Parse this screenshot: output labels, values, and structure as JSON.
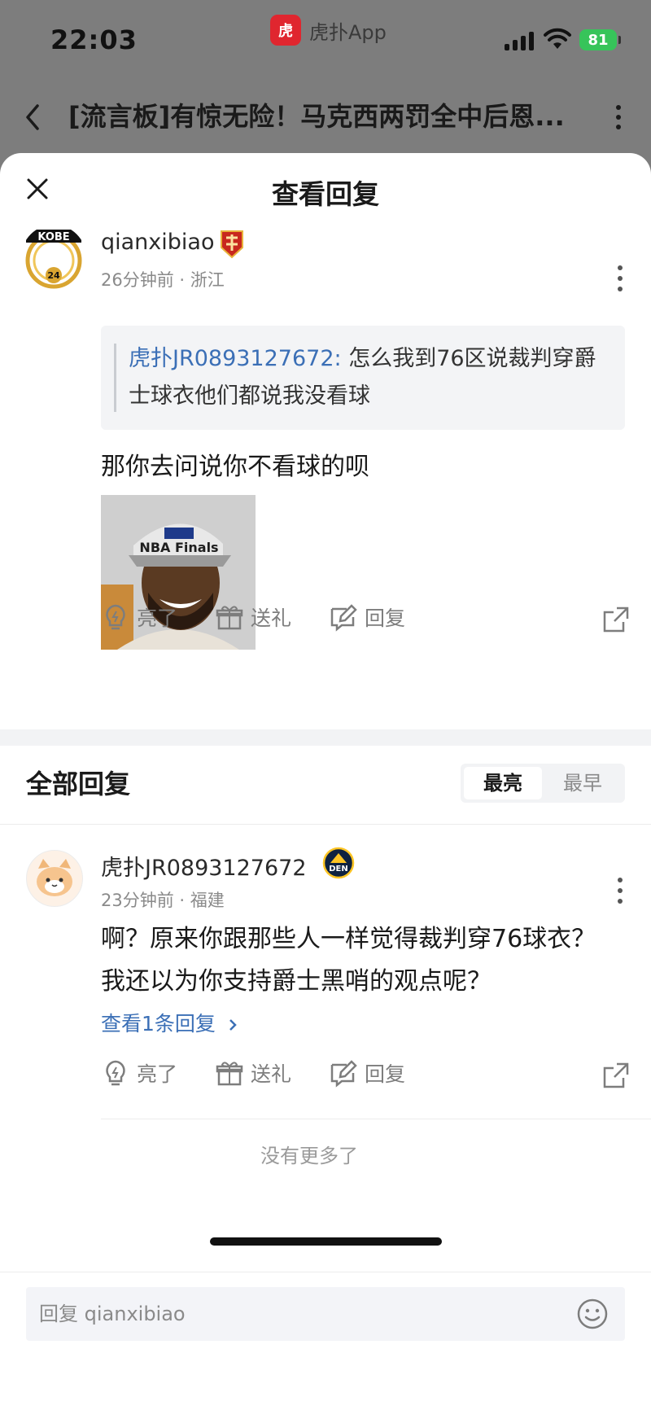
{
  "status_bar": {
    "time": "22:03",
    "app_badge": "APP",
    "app_name": "虎扑App",
    "battery": "81"
  },
  "topbar": {
    "title": "[流言板]有惊无险！马克西两罚全中后恩..."
  },
  "sheet": {
    "title": "查看回复"
  },
  "post": {
    "avatar_badge": "KOBE",
    "avatar_number": "24",
    "username": "qianxibiao",
    "time": "26分钟前",
    "location": "浙江",
    "quote": {
      "user": "虎扑JR0893127672:",
      "text": "怎么我到76区说裁判穿爵士球衣他们都说我没看球"
    },
    "text": "那你去问说你不看球的呗",
    "image_caption": "NBA Finals"
  },
  "actions": {
    "light": "亮了",
    "gift": "送礼",
    "reply": "回复"
  },
  "replies_section": {
    "title": "全部回复",
    "sort_active": "最亮",
    "sort_inactive": "最早"
  },
  "reply": {
    "username": "虎扑JR0893127672",
    "badge": "DEN",
    "time": "23分钟前",
    "location": "福建",
    "text": "啊？原来你跟那些人一样觉得裁判穿76球衣？我还以为你支持爵士黑哨的观点呢？",
    "view_replies": "查看1条回复"
  },
  "footer": {
    "no_more": "没有更多了",
    "input_placeholder": "回复 qianxibiao"
  },
  "colors": {
    "accent_blue": "#3b6fb6",
    "hupu_red": "#e0262f",
    "battery_green": "#37c45a"
  }
}
